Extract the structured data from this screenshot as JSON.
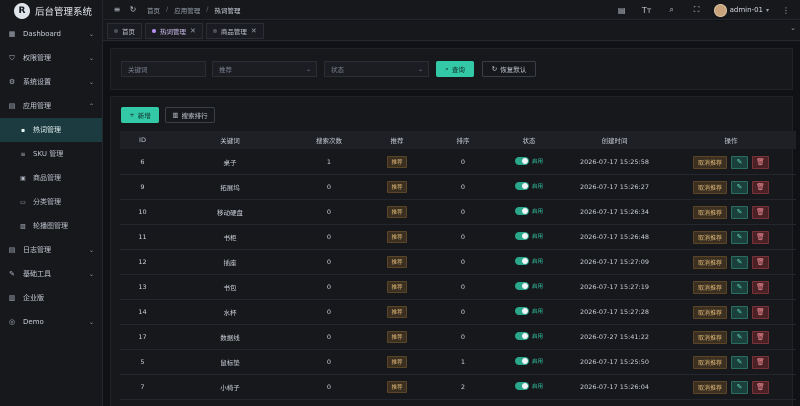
{
  "app": {
    "title": "后台管理系统",
    "logo_char": "R"
  },
  "sidebar": {
    "items": [
      {
        "icon": "dashboard-icon",
        "glyph": "▦",
        "label": "Dashboard",
        "chevron": "⌄"
      },
      {
        "icon": "shield-icon",
        "glyph": "⛉",
        "label": "权限管理",
        "chevron": "⌄"
      },
      {
        "icon": "gear-icon",
        "glyph": "⚙",
        "label": "系统设置",
        "chevron": "⌄"
      },
      {
        "icon": "apps-icon",
        "glyph": "▤",
        "label": "应用管理",
        "chevron": "⌃"
      }
    ],
    "sub_items": [
      {
        "icon": "grid-icon",
        "glyph": "▪",
        "label": "热词管理"
      },
      {
        "icon": "list-icon",
        "glyph": "≡",
        "label": "SKU 管理"
      },
      {
        "icon": "bag-icon",
        "glyph": "▣",
        "label": "商品管理"
      },
      {
        "icon": "folder-icon",
        "glyph": "▭",
        "label": "分类管理"
      },
      {
        "icon": "image-icon",
        "glyph": "▨",
        "label": "轮播图管理"
      }
    ],
    "items_bottom": [
      {
        "icon": "log-icon",
        "glyph": "▤",
        "label": "日志管理",
        "chevron": "⌄"
      },
      {
        "icon": "tool-icon",
        "glyph": "✎",
        "label": "基础工具",
        "chevron": "⌄"
      },
      {
        "icon": "building-icon",
        "glyph": "▥",
        "label": "企业版",
        "chevron": ""
      },
      {
        "icon": "globe-icon",
        "glyph": "◎",
        "label": "Demo",
        "chevron": "⌄"
      }
    ]
  },
  "topbar": {
    "menu_glyph": "≡",
    "refresh_glyph": "↻",
    "breadcrumb": [
      "首页",
      "应用管理",
      "热词管理"
    ],
    "sep": "/",
    "right_icons": [
      {
        "name": "notice-icon",
        "glyph": "▤"
      },
      {
        "name": "font-size-icon",
        "glyph": "Tт"
      },
      {
        "name": "search-icon",
        "glyph": "⌕"
      },
      {
        "name": "fullscreen-icon",
        "glyph": "⛶"
      }
    ],
    "user": "admin-01",
    "user_chevron": "▾",
    "more_glyph": "⋮"
  },
  "tabs": [
    {
      "label": "首页",
      "closable": false,
      "active": false
    },
    {
      "label": "热词管理",
      "closable": true,
      "active": true
    },
    {
      "label": "商品管理",
      "closable": true,
      "active": false
    }
  ],
  "tab_close_glyph": "✕",
  "tabs_chevron": "⌄",
  "filters": {
    "keyword_placeholder": "关键词",
    "recommend_placeholder": "推荐",
    "status_placeholder": "状态",
    "caret": "⌄",
    "search_label": "查询",
    "search_glyph": "⌕",
    "reset_label": "恢复默认",
    "reset_glyph": "↻"
  },
  "toolbar": {
    "add_label": "新增",
    "add_glyph": "+",
    "rank_label": "搜索排行",
    "rank_glyph": "▥"
  },
  "table": {
    "headers": [
      "ID",
      "关键词",
      "搜索次数",
      "推荐",
      "排序",
      "状态",
      "创建时间",
      "操作"
    ],
    "recommend_tag": "推荐",
    "status_label": "启用",
    "cancel_label": "取消推荐",
    "edit_glyph": "✎",
    "delete_glyph": "🗑",
    "rows": [
      {
        "id": "6",
        "kw": "桌子",
        "count": "1",
        "sort": "0",
        "time": "2026-07-17 15:25:58"
      },
      {
        "id": "9",
        "kw": "拓展坞",
        "count": "0",
        "sort": "0",
        "time": "2026-07-17 15:26:27"
      },
      {
        "id": "10",
        "kw": "移动硬盘",
        "count": "0",
        "sort": "0",
        "time": "2026-07-17 15:26:34"
      },
      {
        "id": "11",
        "kw": "书柜",
        "count": "0",
        "sort": "0",
        "time": "2026-07-17 15:26:48"
      },
      {
        "id": "12",
        "kw": "插座",
        "count": "0",
        "sort": "0",
        "time": "2026-07-17 15:27:09"
      },
      {
        "id": "13",
        "kw": "书包",
        "count": "0",
        "sort": "0",
        "time": "2026-07-17 15:27:19"
      },
      {
        "id": "14",
        "kw": "水杯",
        "count": "0",
        "sort": "0",
        "time": "2026-07-17 15:27:28"
      },
      {
        "id": "17",
        "kw": "数据线",
        "count": "0",
        "sort": "0",
        "time": "2026-07-27 15:41:22"
      },
      {
        "id": "5",
        "kw": "鼠标垫",
        "count": "0",
        "sort": "1",
        "time": "2026-07-17 15:25:50"
      },
      {
        "id": "7",
        "kw": "小椅子",
        "count": "0",
        "sort": "2",
        "time": "2026-07-17 15:26:04"
      }
    ]
  }
}
